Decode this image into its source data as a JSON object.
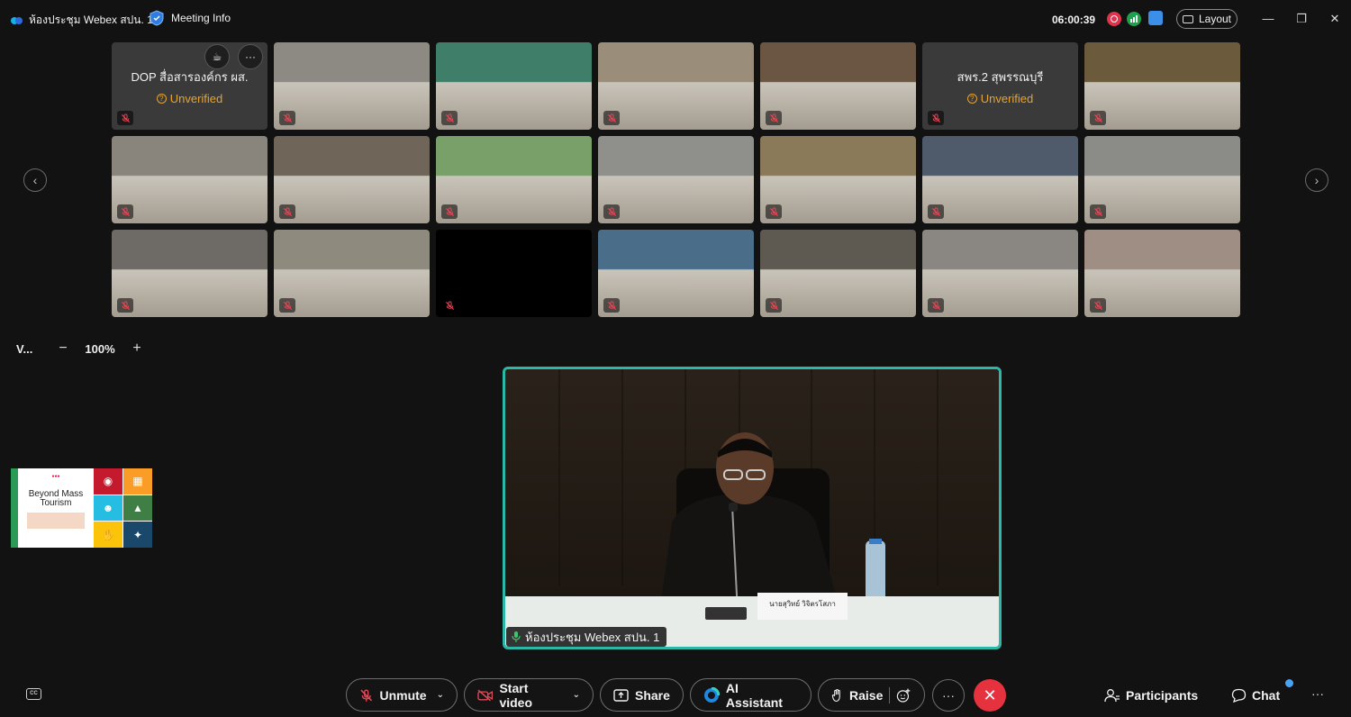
{
  "window": {
    "title": "ห้องประชุม Webex สปน. 1",
    "meeting_info_label": "Meeting Info",
    "clock": "06:00:39",
    "layout_label": "Layout"
  },
  "tiles": [
    {
      "type": "name",
      "name": "DOP สื่อสารองค์กร ผส.",
      "status": "Unverified",
      "bg": "#3a3a3a"
    },
    {
      "type": "video",
      "bg": "#8d8a84"
    },
    {
      "type": "video",
      "bg": "#3f7f6a"
    },
    {
      "type": "video",
      "bg": "#9a8d7a"
    },
    {
      "type": "video",
      "bg": "#6a5642"
    },
    {
      "type": "name",
      "name": "สพร.2 สุพรรณบุรี",
      "status": "Unverified",
      "bg": "#3a3a3a"
    },
    {
      "type": "video",
      "bg": "#6b5a3c"
    },
    {
      "type": "video",
      "bg": "#8a857c"
    },
    {
      "type": "video",
      "bg": "#6f6659"
    },
    {
      "type": "video",
      "bg": "#7aa06a"
    },
    {
      "type": "video",
      "bg": "#8f8f8c"
    },
    {
      "type": "video",
      "bg": "#8a7a5a"
    },
    {
      "type": "video",
      "bg": "#4f5a6a"
    },
    {
      "type": "video",
      "bg": "#8b8b88"
    },
    {
      "type": "video",
      "bg": "#6e6a66"
    },
    {
      "type": "video",
      "bg": "#8f8a7e"
    },
    {
      "type": "video",
      "bg": "#000000"
    },
    {
      "type": "video",
      "bg": "#4a6e8a"
    },
    {
      "type": "video",
      "bg": "#5e5a52"
    },
    {
      "type": "video",
      "bg": "#8a8682"
    },
    {
      "type": "video",
      "bg": "#9e8e84"
    }
  ],
  "zoom": {
    "view_label": "V...",
    "minus": "−",
    "value": "100%",
    "plus": "+"
  },
  "thumbnail": {
    "title": "Beyond Mass Tourism"
  },
  "main_speaker": {
    "name": "ห้องประชุม Webex สปน. 1",
    "nameplate": "นายสุวิทย์ วิจิตรโสภา"
  },
  "toolbar": {
    "cc_label": "CC",
    "unmute": "Unmute",
    "start_video": "Start video",
    "share": "Share",
    "ai_assistant": "AI Assistant",
    "raise": "Raise",
    "more": "···",
    "participants": "Participants",
    "chat": "Chat",
    "overflow": "···"
  },
  "colors": {
    "accent_border": "#2bb8a8",
    "end_call": "#e5323e",
    "unverified": "#e8a328",
    "mute_red": "#e04a5a"
  }
}
